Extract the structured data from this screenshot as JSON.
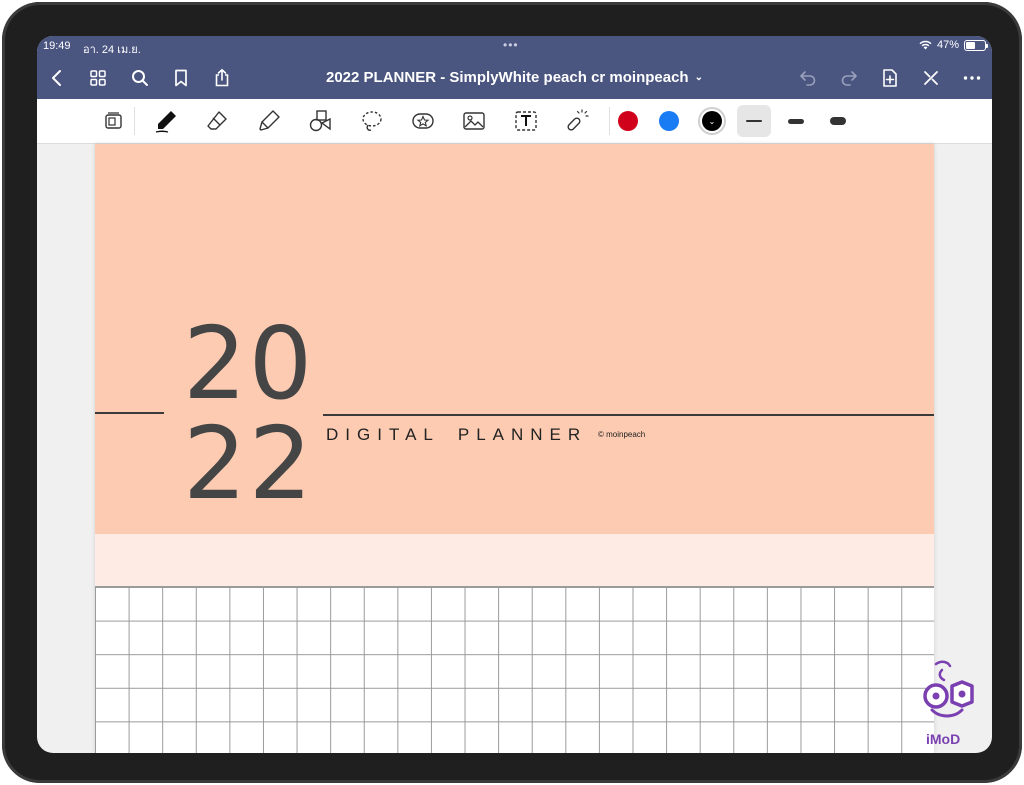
{
  "status_bar": {
    "time": "19:49",
    "date": "อา. 24 เม.ย.",
    "multitask": "•••",
    "battery": "47%"
  },
  "nav": {
    "title": "2022 PLANNER - SimplyWhite peach cr moinpeach",
    "title_chevron": "⌄",
    "left_icons": [
      "back-icon",
      "thumbnails-icon",
      "search-icon",
      "bookmark-icon",
      "share-icon"
    ],
    "right_icons": [
      "undo-icon",
      "redo-icon",
      "add-page-icon",
      "close-editing-icon",
      "more-icon"
    ]
  },
  "toolbar": {
    "tools": [
      "zoom-window-icon",
      "pen-icon",
      "eraser-icon",
      "highlighter-icon",
      "shapes-icon",
      "lasso-icon",
      "elements-icon",
      "image-icon",
      "text-icon",
      "laser-pointer-icon"
    ],
    "selected_tool": "pen-icon",
    "colors": [
      "#d0021b",
      "#1a7cf5",
      "#000000"
    ],
    "selected_color": "#000000",
    "stroke_sizes": [
      "thin",
      "medium",
      "thick"
    ],
    "selected_stroke": "thin"
  },
  "page": {
    "year_top": "20",
    "year_bottom": "22",
    "subtitle_word1": "DIGITAL",
    "subtitle_word2": "PLANNER",
    "credit": "© moinpeach",
    "cover_color": "#fdcbb1",
    "band_color": "#feece4"
  },
  "watermark": {
    "label": "iMoD",
    "color": "#7a3fb0"
  }
}
